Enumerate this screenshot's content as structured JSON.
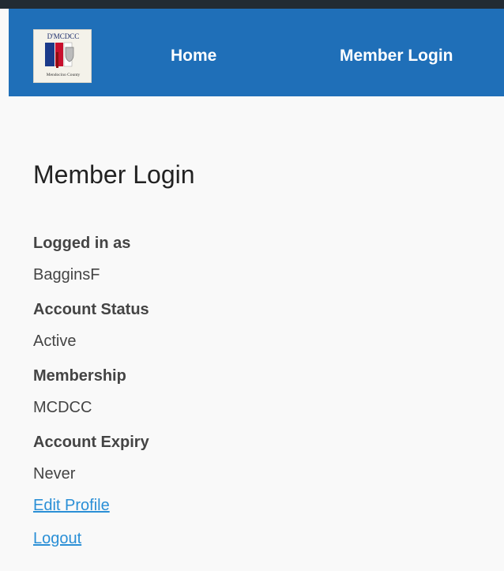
{
  "nav": {
    "logo": {
      "name": "mcdcc-logo-icon",
      "text_top": "D'MCDCC",
      "text_bottom": "Mendocino County"
    },
    "links": [
      "Home",
      "Member Login"
    ]
  },
  "main": {
    "title": "Member Login",
    "fields": [
      {
        "label": "Logged in as",
        "value": "BagginsF"
      },
      {
        "label": "Account Status",
        "value": "Active"
      },
      {
        "label": "Membership",
        "value": "MCDCC"
      },
      {
        "label": "Account Expiry",
        "value": "Never"
      }
    ],
    "actions": [
      "Edit Profile",
      "Logout"
    ]
  },
  "colors": {
    "navbar": "#1f6fb8",
    "top_strip": "#222b33",
    "background": "#f9f9f9",
    "link": "#2a8fd6",
    "text": "#444444"
  }
}
